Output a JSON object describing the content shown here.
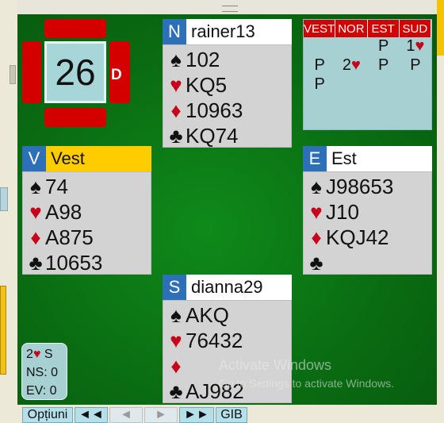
{
  "board": {
    "number": "26",
    "dealer_marker": "D"
  },
  "north": {
    "letter": "N",
    "name": "rainer13",
    "suits": [
      {
        "sym": "♠",
        "cards": "102",
        "color": "black"
      },
      {
        "sym": "♥",
        "cards": "KQ5",
        "color": "red"
      },
      {
        "sym": "♦",
        "cards": "10963",
        "color": "red"
      },
      {
        "sym": "♣",
        "cards": "KQ74",
        "color": "black"
      }
    ]
  },
  "west": {
    "letter": "V",
    "name": "Vest",
    "suits": [
      {
        "sym": "♠",
        "cards": "74",
        "color": "black"
      },
      {
        "sym": "♥",
        "cards": "A98",
        "color": "red"
      },
      {
        "sym": "♦",
        "cards": "A875",
        "color": "red"
      },
      {
        "sym": "♣",
        "cards": "10653",
        "color": "black"
      }
    ]
  },
  "east": {
    "letter": "E",
    "name": "Est",
    "suits": [
      {
        "sym": "♠",
        "cards": "J98653",
        "color": "black"
      },
      {
        "sym": "♥",
        "cards": "J10",
        "color": "red"
      },
      {
        "sym": "♦",
        "cards": "KQJ42",
        "color": "red"
      },
      {
        "sym": "♣",
        "cards": "",
        "color": "black"
      }
    ]
  },
  "south": {
    "letter": "S",
    "name": "dianna29",
    "suits": [
      {
        "sym": "♠",
        "cards": "AKQ",
        "color": "black"
      },
      {
        "sym": "♥",
        "cards": "76432",
        "color": "red"
      },
      {
        "sym": "♦",
        "cards": "",
        "color": "red"
      },
      {
        "sym": "♣",
        "cards": "AJ982",
        "color": "black"
      }
    ]
  },
  "auction": {
    "headers": [
      "VEST",
      "NOR",
      "EST",
      "SUD"
    ],
    "rows": [
      [
        "",
        "",
        "P",
        "1♥"
      ],
      [
        "P",
        "2♥",
        "P",
        "P"
      ],
      [
        "P",
        "",
        "",
        ""
      ]
    ]
  },
  "score": {
    "contract_level": "2",
    "contract_suit": "♥",
    "contract_declarer": "S",
    "ns": "NS: 0",
    "ev": "EV: 0"
  },
  "watermark": {
    "line1": "Activate Windows",
    "line2": "Go to Settings to activate Windows."
  },
  "toolbar": {
    "options": "Opțiuni",
    "first": "◄◄",
    "prev": "◄",
    "next": "►",
    "last": "►►",
    "gib": "GIB"
  },
  "colors": {
    "felt": "#0a6d12",
    "seat_blue": "#2d70b8",
    "vul_red": "#d40000",
    "auction_bg": "#a7d0d3",
    "west_name_bg": "#ffcc00"
  },
  "icons": {
    "grip": "resize-grip-icon"
  }
}
